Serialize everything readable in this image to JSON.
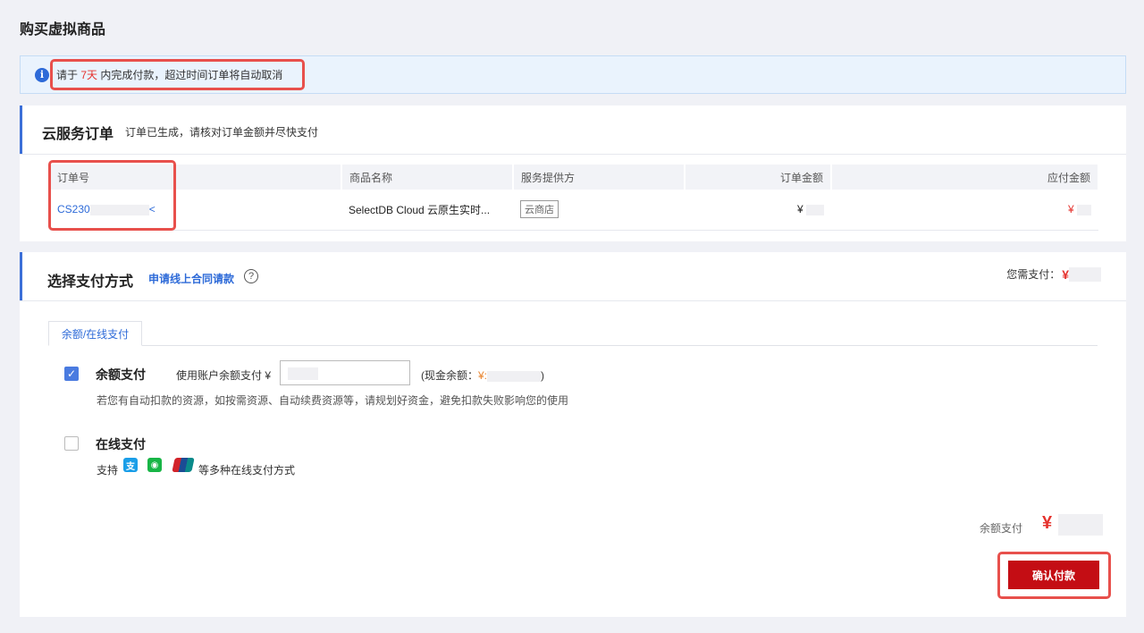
{
  "page_title": "购买虚拟商品",
  "notice": {
    "prefix": "请于 ",
    "days": "7天",
    "suffix": " 内完成付款，超过时间订单将自动取消"
  },
  "order_card": {
    "title": "云服务订单",
    "subtitle": "订单已生成，请核对订单金额并尽快支付",
    "columns": [
      "订单号",
      "商品名称",
      "服务提供方",
      "订单金额",
      "应付金额"
    ],
    "row": {
      "order_no": "CS230",
      "order_no_tail": "<",
      "product": "SelectDB Cloud 云原生实时...",
      "provider": "云商店",
      "order_amount": "¥",
      "pay_amount": "¥"
    }
  },
  "pay_card": {
    "title": "选择支付方式",
    "contract_link": "申请线上合同请款",
    "help": "?",
    "need_pay_label": "您需支付：",
    "need_pay_yen": "¥",
    "tab_label": "余额/在线支付",
    "balance": {
      "title": "余额支付",
      "use_label": "使用账户余额支付 ¥",
      "cash_label": "(现金余额：",
      "cash_yen": "¥:",
      "cash_close": ")",
      "hint": "若您有自动扣款的资源，如按需资源、自动续费资源等，请规划好资金，避免扣款失败影响您的使用"
    },
    "online": {
      "title": "在线支付",
      "support_prefix": "支持",
      "support_suffix": "等多种在线支付方式"
    },
    "summary_label": "余额支付",
    "summary_yen": "¥",
    "confirm_button": "确认付款"
  },
  "colors": {
    "accent": "#2d6ad8",
    "brand_red": "#c40d14",
    "highlight": "#e8504c"
  }
}
